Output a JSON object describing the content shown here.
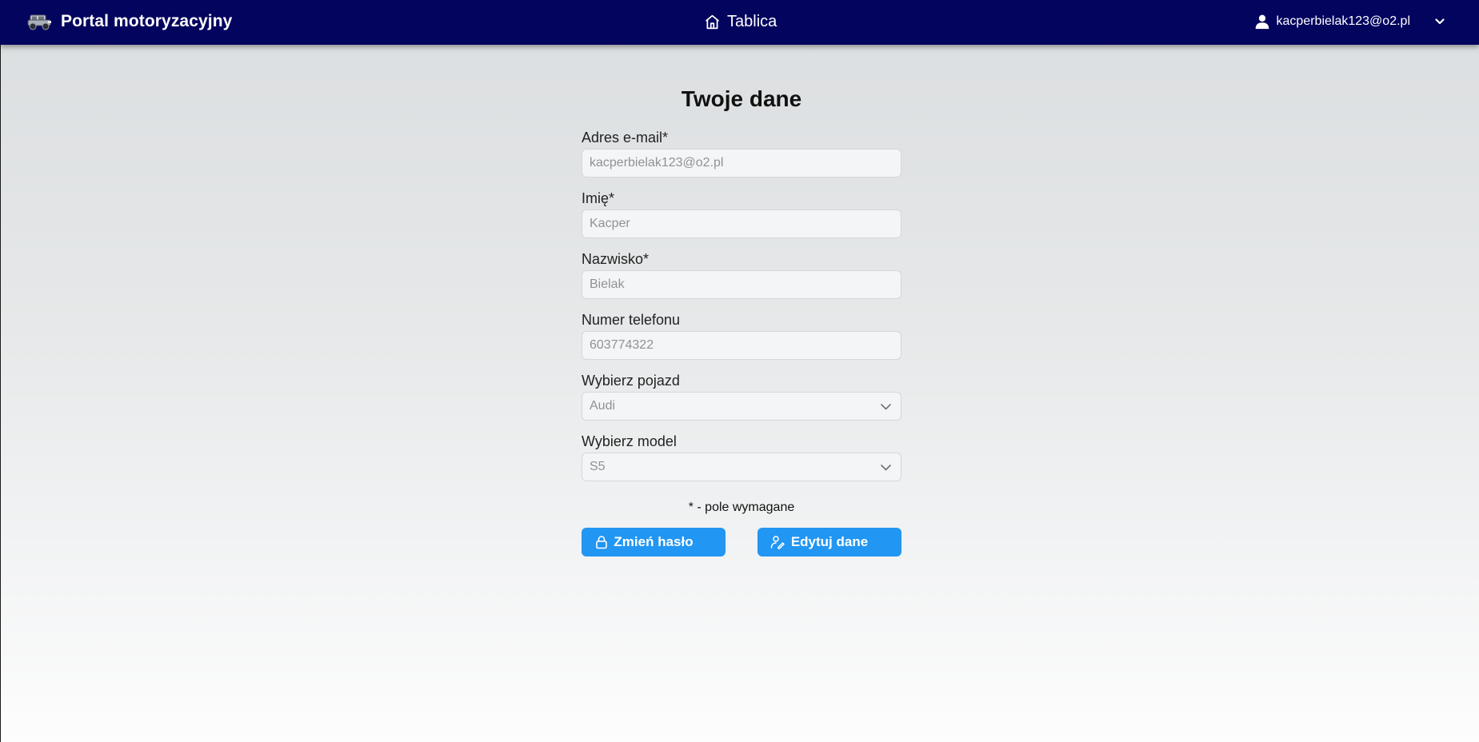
{
  "header": {
    "brand_title": "Portal motoryzacyjny",
    "brand_logo_icon": "car-logo-icon",
    "nav_home_label": "Tablica",
    "nav_home_icon": "home-icon",
    "user_email": "kacperbielak123@o2.pl",
    "user_icon": "user-icon",
    "menu_icon": "chevron-down-icon"
  },
  "form": {
    "title": "Twoje dane",
    "email": {
      "label": "Adres e-mail*",
      "placeholder": "kacperbielak123@o2.pl"
    },
    "first_name": {
      "label": "Imię*",
      "placeholder": "Kacper"
    },
    "last_name": {
      "label": "Nazwisko*",
      "placeholder": "Bielak"
    },
    "phone": {
      "label": "Numer telefonu",
      "placeholder": "603774322"
    },
    "vehicle": {
      "label": "Wybierz pojazd",
      "selected": "Audi"
    },
    "model": {
      "label": "Wybierz model",
      "selected": "S5"
    },
    "required_note": "* - pole wymagane",
    "change_password_label": "Zmień hasło",
    "change_password_icon": "lock-icon",
    "edit_data_label": "Edytuj dane",
    "edit_data_icon": "user-edit-icon"
  },
  "colors": {
    "header_bg": "#03045e",
    "button_bg": "#2196f3",
    "input_bg": "#f4f5f6"
  }
}
